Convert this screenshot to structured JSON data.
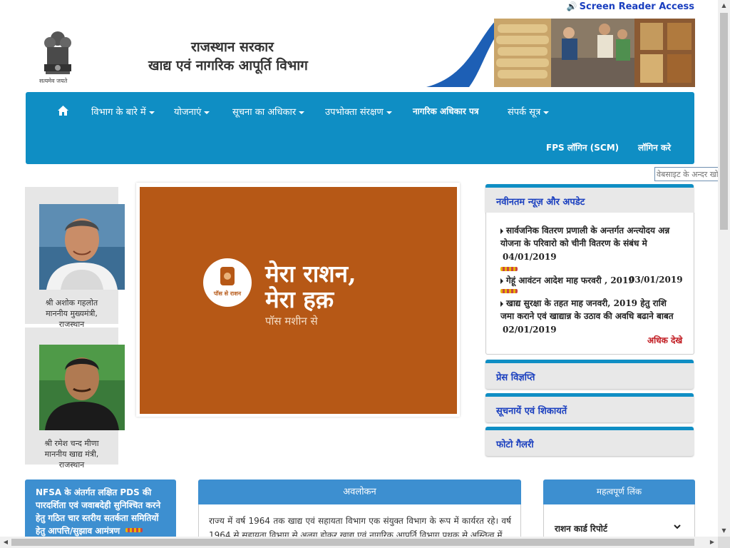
{
  "topbar": {
    "screen_reader": "Screen Reader Access"
  },
  "header": {
    "emblem_caption": "सत्यमेव जयते",
    "title_line1": "राजस्थान सरकार",
    "title_line2": "खाद्य एवं नागरिक आपूर्ति विभाग"
  },
  "nav": {
    "home_icon": "home-icon",
    "items": [
      {
        "label": "विभाग के बारे में"
      },
      {
        "label": "योजनाएं"
      },
      {
        "label": "सूचना का अधिकार"
      },
      {
        "label": "उपभोक्ता संरक्षण"
      },
      {
        "label": "नागरिक अधिकार पत्र"
      },
      {
        "label": "संपर्क सूत्र"
      }
    ],
    "fps_login": "FPS लॉगिन (SCM)",
    "login": "लॉगिन करे",
    "color": "#0f8ec4"
  },
  "search": {
    "placeholder": "वेबसाइट के अन्दर खोजें"
  },
  "officials": [
    {
      "name": "श्री अशोक गहलोत",
      "post": "माननीय मुख्यमंत्री,",
      "state": "राजस्थान"
    },
    {
      "name": "श्री रमेश चन्द मीणा",
      "post": "माननीय खाद्य मंत्री,",
      "state": "राजस्थान"
    }
  ],
  "slider": {
    "logo_text": "पॉस से राशन",
    "line1": "मेरा राशन,",
    "line2": "मेरा हक़",
    "line3": "पॉस मशीन से",
    "background": "#b65816"
  },
  "news": {
    "title": "नवीनतम न्यूज़ और अपडेट",
    "items": [
      {
        "text": "सार्वजनिक वितरण प्रणाली के अन्तर्गत अन्त्योदय अन्न योजना के परिवारो को चीनी वितरण के संबंध मे",
        "date": "04/01/2019"
      },
      {
        "text": "गेहूं आवंटन आदेश माह फरवरी , 2019",
        "date": "03/01/2019"
      },
      {
        "text": "खाद्य सुरक्षा के तहत माह जनवरी, 2019 हेतु राशि जमा कराने एवं खाद्यान्न के उठाव की अवधि बढाने बाबत",
        "date": "02/01/2019"
      }
    ],
    "more": "अधिक देखे"
  },
  "side_panels": [
    "प्रेस विज्ञप्ति",
    "सूचनायें एवं शिकायतें",
    "फोटो गैलरी"
  ],
  "nfsa": {
    "text": "NFSA के अंतर्गत लक्षित PDS की पारदर्शिता एवं जवाबदेही सुनिश्चित करने हेतु गठित चार स्तरीय सतर्कता समितियों हेतु आपत्ति/सुझाव आमंत्रण"
  },
  "overview": {
    "title": "अवलोकन",
    "text": "राज्य में वर्ष 1964 तक खाद्य एवं सहायता विभाग एक संयुक्त विभाग के रूप में कार्यरत रहे। वर्ष 1964 से सहायता विभाग से अलग होकर खाद्य एवं नागरिक आपूर्ति विभाग पृथक से अस्तित्व में"
  },
  "links": {
    "title": "महत्वपूर्ण लिंक",
    "item": "राशन कार्ड रिपोर्ट"
  }
}
